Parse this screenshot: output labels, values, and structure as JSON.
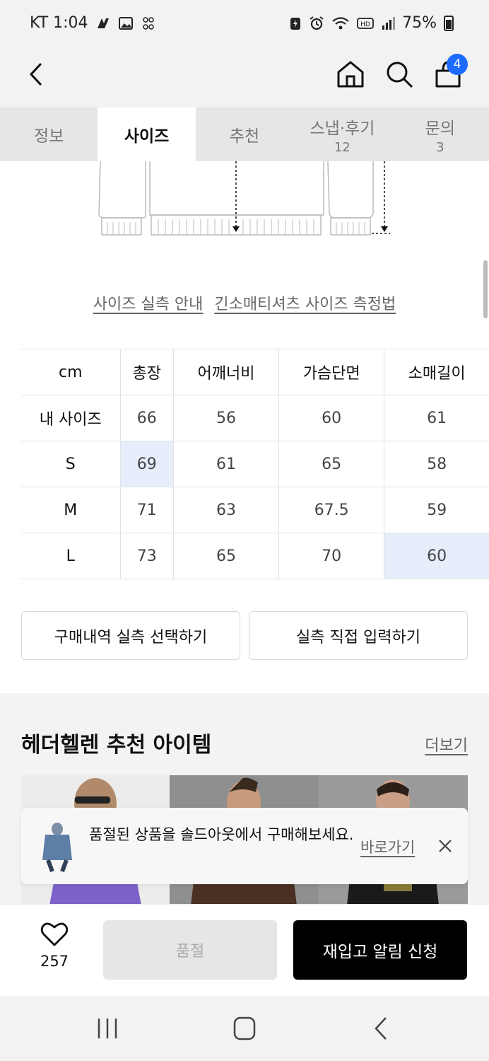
{
  "status_bar": {
    "carrier_time": "KT 1:04",
    "battery": "75%"
  },
  "header": {
    "cart_count": "4"
  },
  "tabs": [
    {
      "label": "정보",
      "count": ""
    },
    {
      "label": "사이즈",
      "count": ""
    },
    {
      "label": "추천",
      "count": ""
    },
    {
      "label": "스냅·후기",
      "count": "12"
    },
    {
      "label": "문의",
      "count": "3"
    }
  ],
  "size_links": {
    "guide": "사이즈 실측 안내",
    "method": "긴소매티셔츠 사이즈 측정법"
  },
  "size_table": {
    "headers": [
      "cm",
      "총장",
      "어깨너비",
      "가슴단면",
      "소매길이"
    ],
    "rows": [
      [
        "내 사이즈",
        "66",
        "56",
        "60",
        "61"
      ],
      [
        "S",
        "69",
        "61",
        "65",
        "58"
      ],
      [
        "M",
        "71",
        "63",
        "67.5",
        "59"
      ],
      [
        "L",
        "73",
        "65",
        "70",
        "60"
      ]
    ]
  },
  "buttons": {
    "purchase_history": "구매내역 실측 선택하기",
    "direct_input": "실측 직접 입력하기"
  },
  "recommend": {
    "title": "헤더헬렌 추천 아이템",
    "more": "더보기"
  },
  "toast": {
    "message": "품절된 상품을 솔드아웃에서 구매해보세요.",
    "link": "바로가기"
  },
  "bottom_bar": {
    "like_count": "257",
    "soldout": "품절",
    "restock": "재입고 알림 신청"
  },
  "colors": {
    "accent_blue": "#1d6bff",
    "highlight": "#e6edfb",
    "primary_black": "#000000"
  }
}
